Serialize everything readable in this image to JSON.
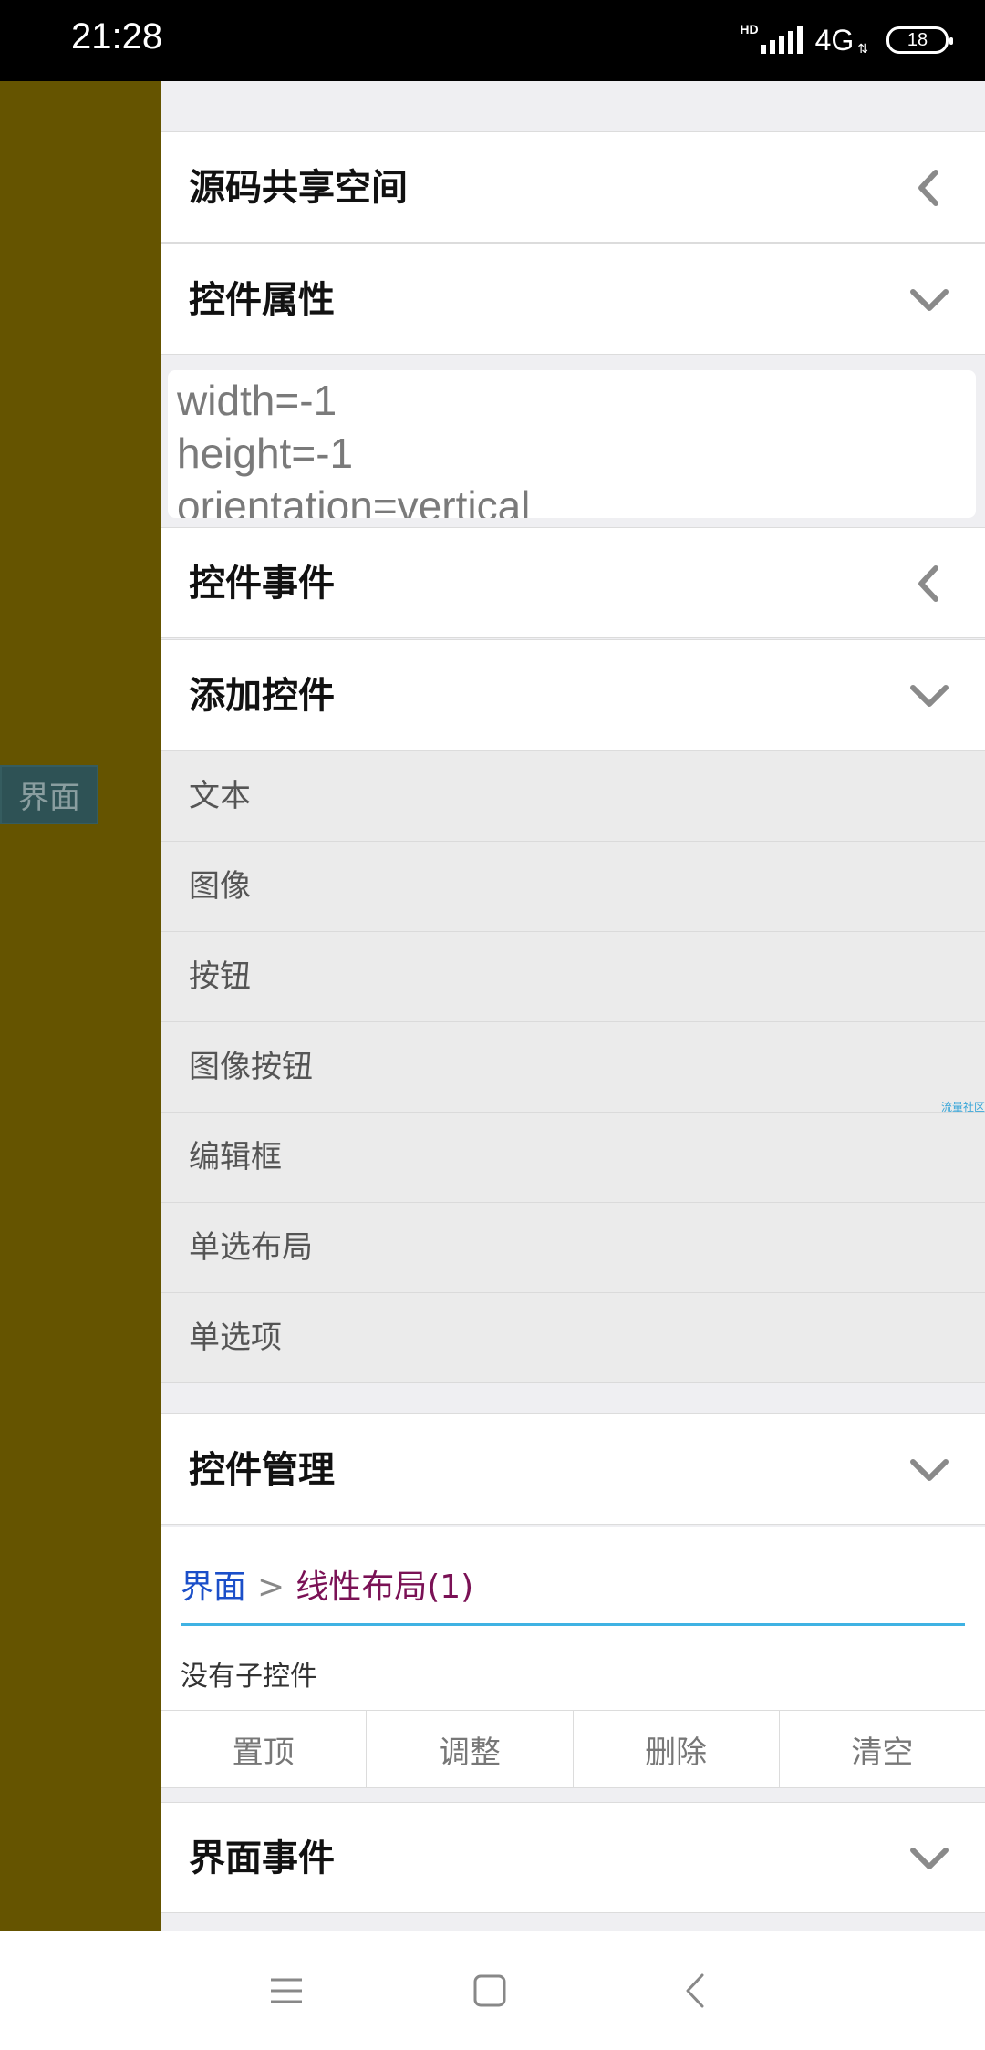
{
  "status_bar": {
    "time": "21:28",
    "hd": "HD",
    "network": "4G",
    "battery": "18",
    "icons": [
      "signal-icon",
      "battery-icon"
    ]
  },
  "left_panel": {
    "tab_label": "界面",
    "bg_color": "#655400"
  },
  "sections": {
    "source_share": "源码共享空间",
    "properties": "控件属性",
    "events": "控件事件",
    "add_control": "添加控件",
    "control_manage": "控件管理",
    "ui_events": "界面事件"
  },
  "properties_text": [
    "width=-1",
    "height=-1",
    "orientation=vertical"
  ],
  "add_items": [
    "文本",
    "图像",
    "按钮",
    "图像按钮",
    "编辑框",
    "单选布局",
    "单选项"
  ],
  "watermark": "流量社区",
  "breadcrumb": {
    "root": "界面",
    "separator": ">",
    "current": "线性布局(1)"
  },
  "no_children": "没有子控件",
  "actions": [
    "置顶",
    "调整",
    "删除",
    "清空"
  ],
  "nav": [
    "menu-icon",
    "home-icon",
    "back-icon"
  ],
  "colors": {
    "accent_line": "#3fb2e3",
    "breadcrumb_root": "#1b4fc9",
    "breadcrumb_current": "#7a1155"
  }
}
